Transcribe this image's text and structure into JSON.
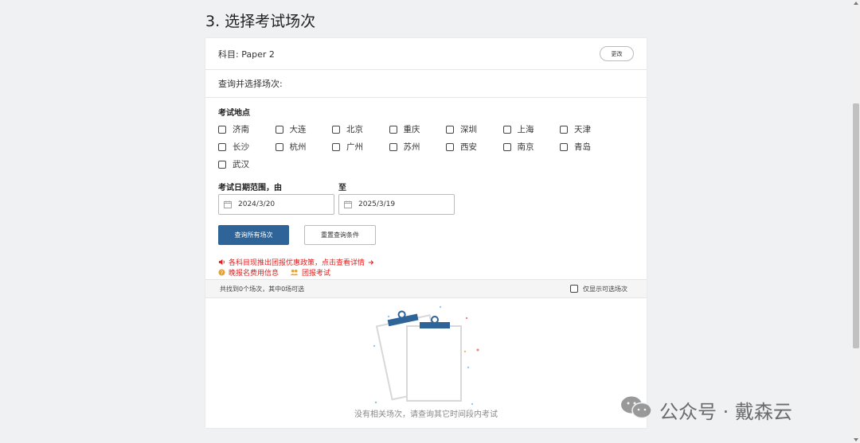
{
  "page_title": "3. 选择考试场次",
  "subject": {
    "label": "科目: Paper 2",
    "change_label": "更改"
  },
  "query_label": "查询并选择场次:",
  "location": {
    "label": "考试地点",
    "items": [
      "济南",
      "大连",
      "北京",
      "重庆",
      "深圳",
      "上海",
      "天津",
      "长沙",
      "杭州",
      "广州",
      "苏州",
      "西安",
      "南京",
      "青岛",
      "武汉"
    ]
  },
  "dates": {
    "from_label": "考试日期范围，由",
    "to_label": "至",
    "from_value": "2024/3/20",
    "to_value": "2025/3/19"
  },
  "buttons": {
    "search": "查询所有场次",
    "reset": "重置查询条件"
  },
  "promo": {
    "line1": "各科目现推出团报优惠政策，点击查看详情",
    "late_fee": "晚报名费用信息",
    "group": "团报考试"
  },
  "results": {
    "summary": "共找到0个场次，其中0场可选",
    "only_available": "仅显示可选场次"
  },
  "empty_message": "没有相关场次，请查询其它时间段内考试",
  "watermark": "公众号 · 戴森云",
  "colors": {
    "primary": "#2e6498",
    "alert": "#e02020",
    "warning": "#f0a020"
  }
}
